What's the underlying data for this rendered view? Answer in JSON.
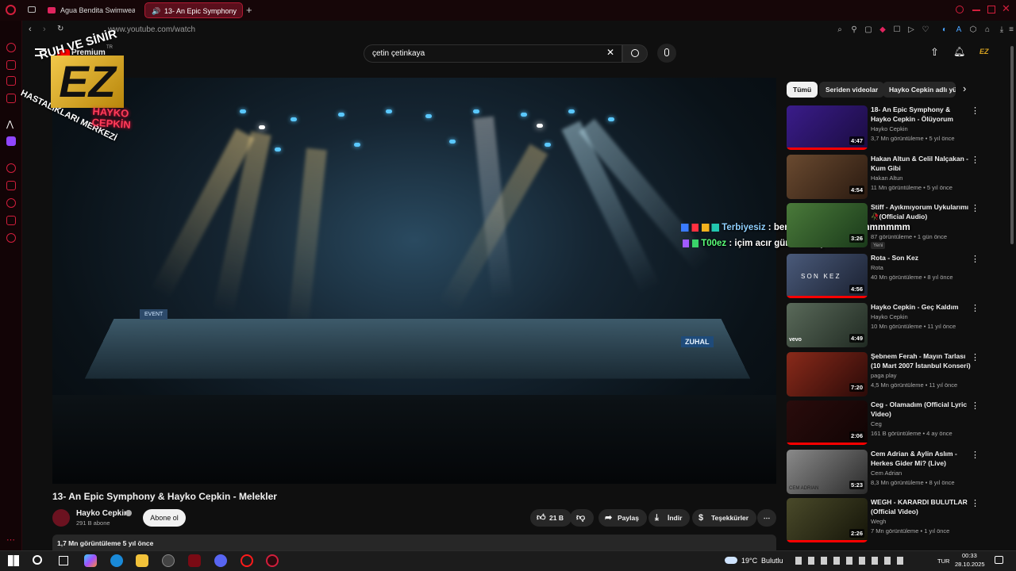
{
  "browser": {
    "tabs": [
      {
        "label": "Agua Bendita Swimwear"
      },
      {
        "label": "13- An Epic Symphony"
      }
    ],
    "url": "www.youtube.com/watch",
    "new_tab": "+"
  },
  "youtube": {
    "brand": "Premium",
    "brand_tr": "TR",
    "search_value": "çetin çetinkaya",
    "avatar_text": "EZ"
  },
  "overlay_logo": {
    "top_arc": "RUH VE SİNİR",
    "side_arc": "HASTALIKLARI MERKEZİ",
    "mark": "EZ",
    "neon": "HAYKO CEPKİN"
  },
  "chat": [
    {
      "user": "Terbiyesiz",
      "message": " : ben oynayamammmmmmmmm",
      "user_color": "#8fd0ff"
    },
    {
      "user": "T00ez",
      "message": " : içim acır gündüzler yakarrrr",
      "user_color": "#5aff7a"
    }
  ],
  "video": {
    "stage_sign_left": "EVENT",
    "stage_sign_right": "ZUHAL",
    "title": "13- An Epic Symphony & Hayko Cepkin - Melekler",
    "channel": "Hayko Cepkin",
    "subscribers": "291 B abone",
    "subscribe_label": "Abone ol",
    "likes": "21 B",
    "share_label": "Paylaş",
    "download_label": "İndir",
    "thanks_label": "Teşekkürler",
    "views_date": "1,7 Mn görüntüleme  5 yıl önce"
  },
  "chips": [
    "Tümü",
    "Seriden videolar",
    "Hayko Cepkin adlı yükleyiciden"
  ],
  "recommendations": [
    {
      "title": "18- An Epic Symphony & Hayko Cepkin - Ölüyorum",
      "channel": "Hayko Cepkin",
      "meta": "3,7 Mn görüntüleme • 5 yıl önce",
      "duration": "4:47",
      "thumb": "#2a1a6a"
    },
    {
      "title": "Hakan Altun & Celil Nalçakan - Kum Gibi",
      "channel": "Hakan Altun",
      "meta": "11 Mn görüntüleme • 5 yıl önce",
      "duration": "4:54",
      "thumb": "#4a3020"
    },
    {
      "title": "Stiff - Ayıkmıyorum Uykularımı 🥀(Official Audio)",
      "channel": "",
      "meta": "87 görüntüleme • 1 gün önce",
      "duration": "3:26",
      "thumb": "#2e5a2a",
      "badge": "Yeni"
    },
    {
      "title": "Rota - Son Kez",
      "channel": "Rota",
      "meta": "40 Mn görüntüleme • 8 yıl önce",
      "duration": "4:56",
      "thumb": "#2a3a5a",
      "thumb_text": "S O N   K E Z"
    },
    {
      "title": "Hayko Cepkin - Geç Kaldım",
      "channel": "Hayko Cepkin",
      "meta": "10 Mn görüntüleme • 11 yıl önce",
      "duration": "4:49",
      "thumb": "#3a4a40",
      "thumb_text": "vevo"
    },
    {
      "title": "Şebnem Ferah - Mayın Tarlası (10 Mart 2007 İstanbul Konseri)",
      "channel": "paga play",
      "meta": "4,5 Mn görüntüleme • 11 yıl önce",
      "duration": "7:20",
      "thumb": "#5a1a10"
    },
    {
      "title": "Ceg - Olamadım (Official Lyric Video)",
      "channel": "Ceg",
      "meta": "161 B görüntüleme • 4 ay önce",
      "duration": "2:06",
      "thumb": "#1a0a0a"
    },
    {
      "title": "Cem Adrian & Aylin Aslım - Herkes Gider Mi? (Live)",
      "channel": "Cem Adrian",
      "meta": "8,3 Mn görüntüleme • 8 yıl önce",
      "duration": "5:23",
      "thumb": "#505050",
      "thumb_text": "CEM ADRIAN"
    },
    {
      "title": "WEGH - KARARDI BULUTLAR (Official Video)",
      "channel": "Wegh",
      "meta": "7 Mn görüntüleme • 1 yıl önce",
      "duration": "2:26",
      "thumb": "#2a2a1a"
    }
  ],
  "taskbar": {
    "weather": "19°C",
    "weather_desc": "Bulutlu",
    "lang": "TUR",
    "time": "00:33",
    "date": "28.10.2025"
  },
  "colors": {
    "accent": "#ff0000",
    "opera": "#d21e3c"
  }
}
